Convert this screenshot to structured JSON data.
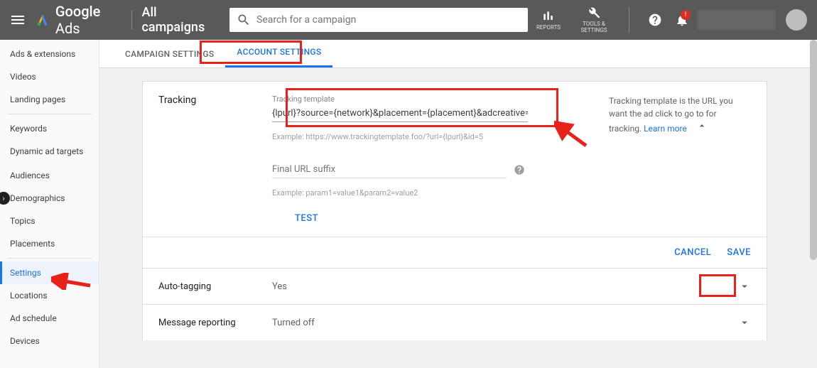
{
  "header": {
    "product": "Google",
    "product_suffix": "Ads",
    "context": "All campaigns",
    "search_placeholder": "Search for a campaign",
    "reports_label": "REPORTS",
    "tools_label": "TOOLS & SETTINGS",
    "bell_badge": "!"
  },
  "sidebar": {
    "items": [
      {
        "label": "Ads & extensions"
      },
      {
        "label": "Videos"
      },
      {
        "label": "Landing pages"
      },
      {
        "label": "Keywords"
      },
      {
        "label": "Dynamic ad targets"
      },
      {
        "label": "Audiences"
      },
      {
        "label": "Demographics"
      },
      {
        "label": "Topics"
      },
      {
        "label": "Placements"
      },
      {
        "label": "Settings",
        "selected": true
      },
      {
        "label": "Locations"
      },
      {
        "label": "Ad schedule"
      },
      {
        "label": "Devices"
      }
    ]
  },
  "tabs": {
    "campaign": "CAMPAIGN SETTINGS",
    "account": "ACCOUNT SETTINGS"
  },
  "tracking": {
    "section_title": "Tracking",
    "template_label": "Tracking template",
    "template_value": "{lpurl}?source={network}&placement={placement}&adcreative={c",
    "template_example": "Example: https://www.trackingtemplate.foo/?url={lpurl}&id=5",
    "suffix_label": "Final URL suffix",
    "suffix_example": "Example: param1=value1&param2=value2",
    "test_label": "TEST",
    "help_text": "Tracking template is the URL you want the ad click to go to for tracking. ",
    "learn_more": "Learn more"
  },
  "actions": {
    "cancel": "CANCEL",
    "save": "SAVE"
  },
  "rows": [
    {
      "label": "Auto-tagging",
      "value": "Yes"
    },
    {
      "label": "Message reporting",
      "value": "Turned off"
    }
  ]
}
